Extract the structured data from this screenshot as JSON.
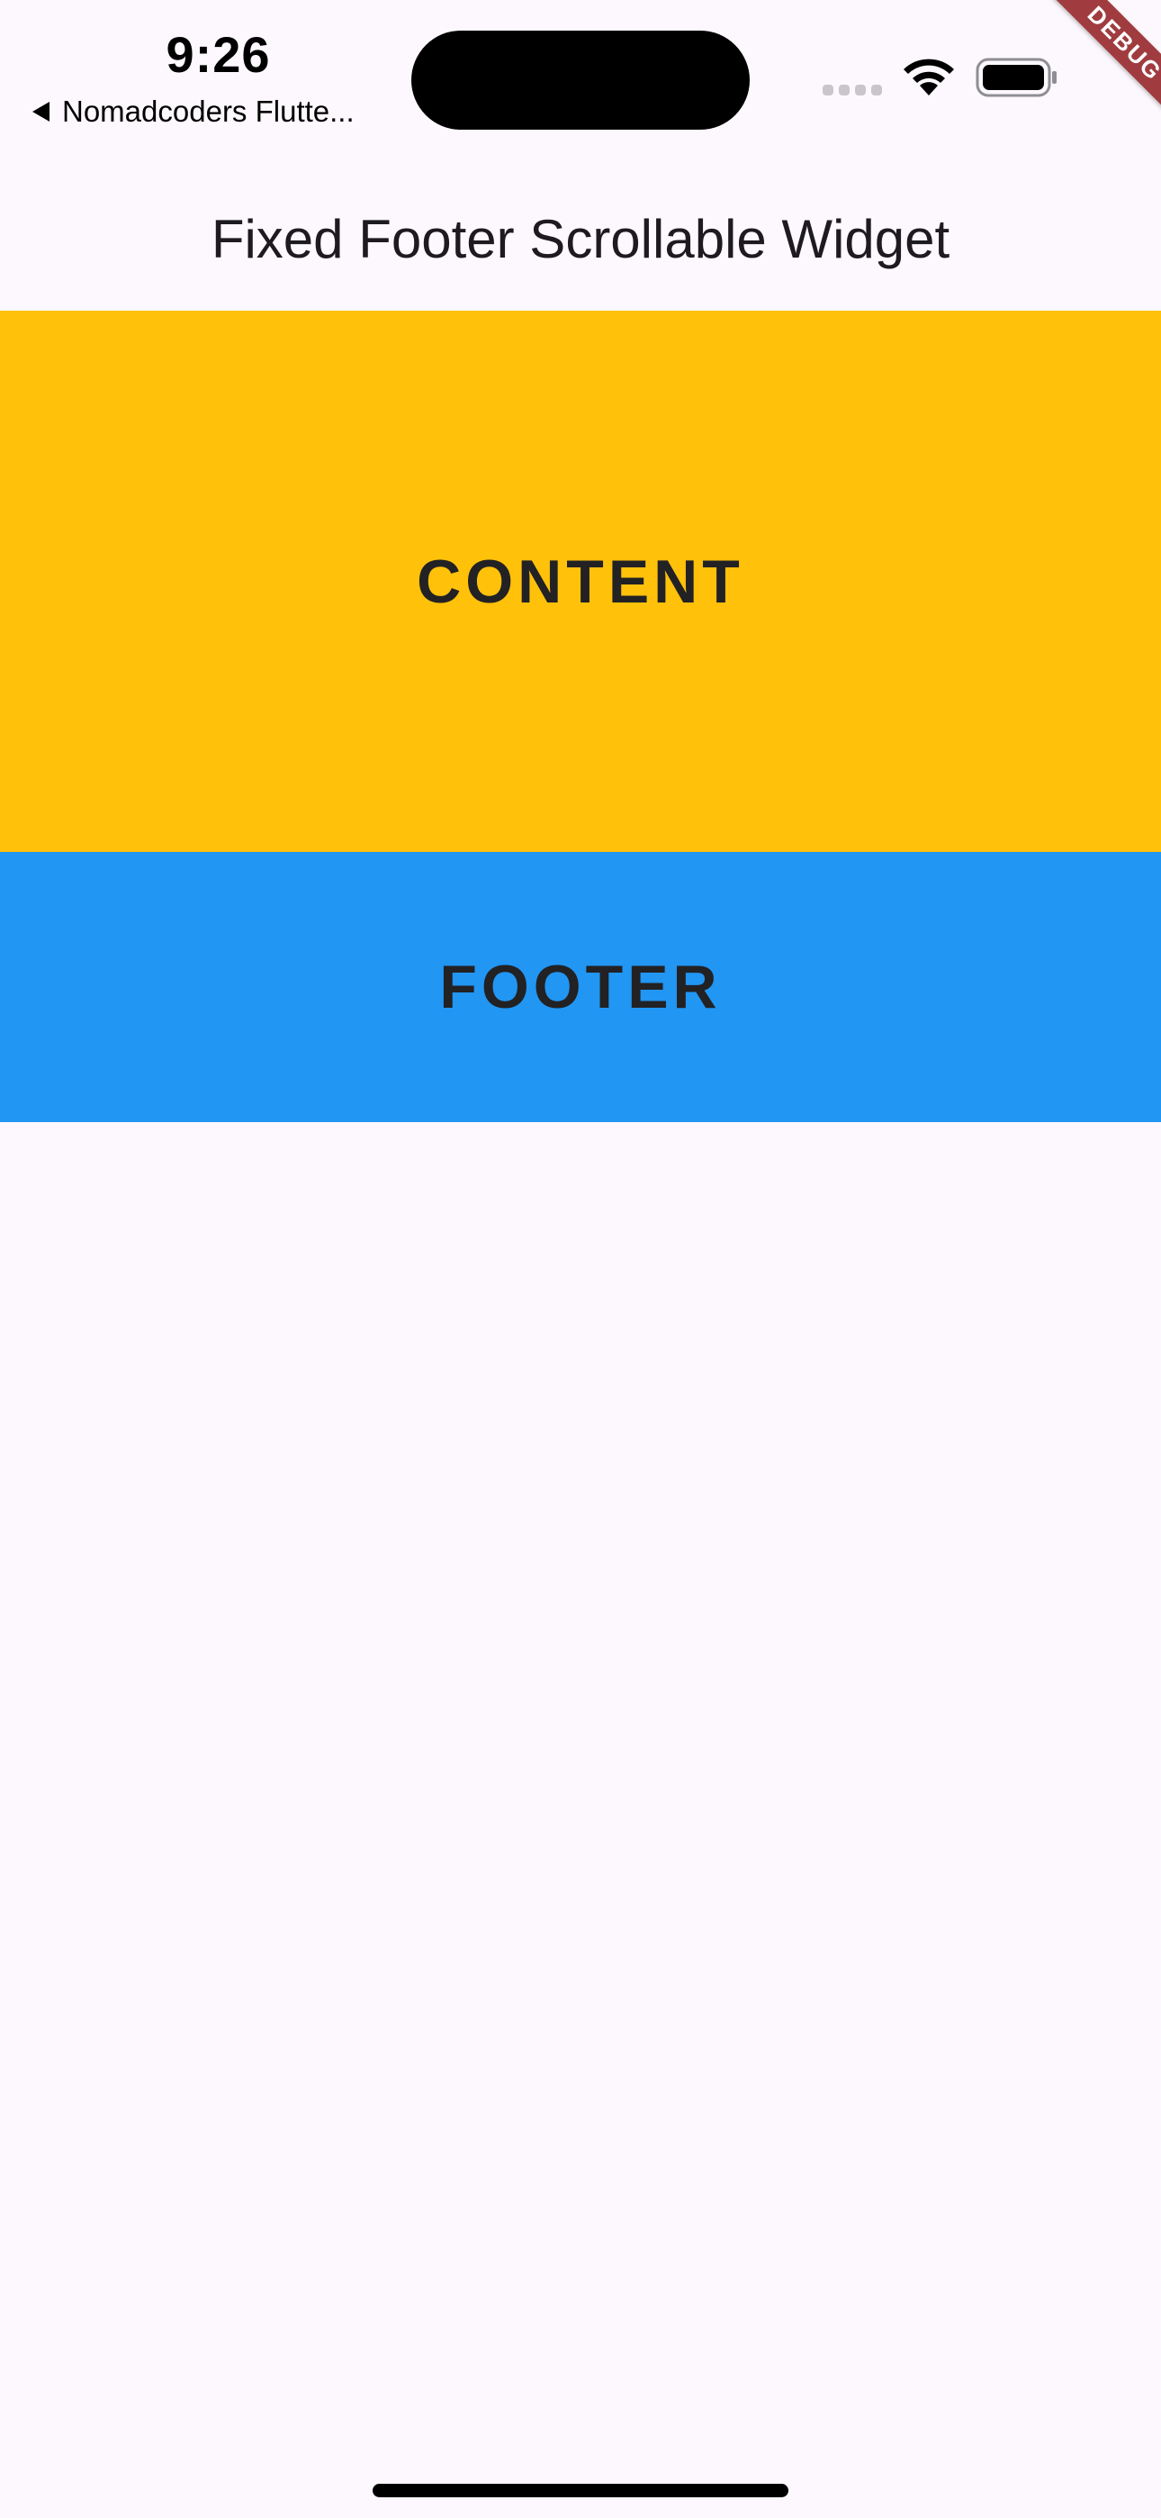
{
  "status_bar": {
    "time": "9:26",
    "back_app_label": "Nomadcoders Flutte...",
    "icons": [
      "cellular-signal-icon",
      "wifi-icon",
      "battery-icon"
    ]
  },
  "debug_banner": {
    "label": "DEBUG",
    "color": "#a03c40"
  },
  "app_bar": {
    "title": "Fixed Footer Scrollable Widget"
  },
  "content": {
    "label": "CONTENT",
    "color": "#ffc10a"
  },
  "footer": {
    "label": "FOOTER",
    "color": "#2196f3"
  },
  "colors": {
    "background": "#fdf8fd",
    "text": "#222124"
  }
}
